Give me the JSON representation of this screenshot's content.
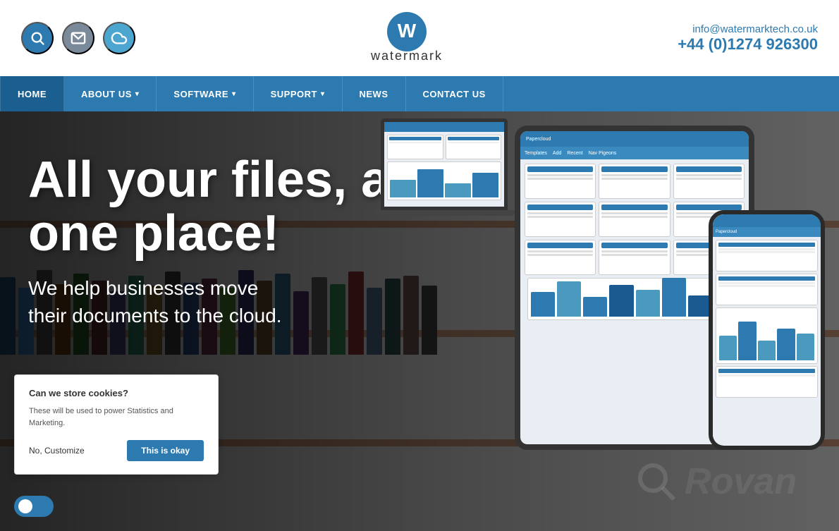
{
  "header": {
    "email": "info@watermarktech.co.uk",
    "phone": "+44 (0)1274 926300",
    "logo_text": "watermark"
  },
  "nav": {
    "items": [
      {
        "label": "HOME",
        "has_dropdown": false,
        "active": true
      },
      {
        "label": "ABOUT US",
        "has_dropdown": true,
        "active": false
      },
      {
        "label": "SOFTWARE",
        "has_dropdown": true,
        "active": false
      },
      {
        "label": "SUPPORT",
        "has_dropdown": true,
        "active": false
      },
      {
        "label": "NEWS",
        "has_dropdown": false,
        "active": false
      },
      {
        "label": "CONTACT US",
        "has_dropdown": false,
        "active": false
      }
    ]
  },
  "hero": {
    "title_line1": "All your files, all in",
    "title_line2": "one place!",
    "subtitle": "We help businesses move\ntheir documents to the cloud."
  },
  "cookie_banner": {
    "title": "Can we store cookies?",
    "description": "These will be used to power Statistics and Marketing.",
    "btn_no": "No, Customize",
    "btn_yes": "This is okay"
  },
  "icons": {
    "search": "🔍",
    "mail": "✉",
    "cloud": "☁",
    "chevron": "▾"
  },
  "colors": {
    "primary_blue": "#2d7ab0",
    "nav_blue": "#2d7ab0",
    "dark": "#222",
    "white": "#fff"
  }
}
